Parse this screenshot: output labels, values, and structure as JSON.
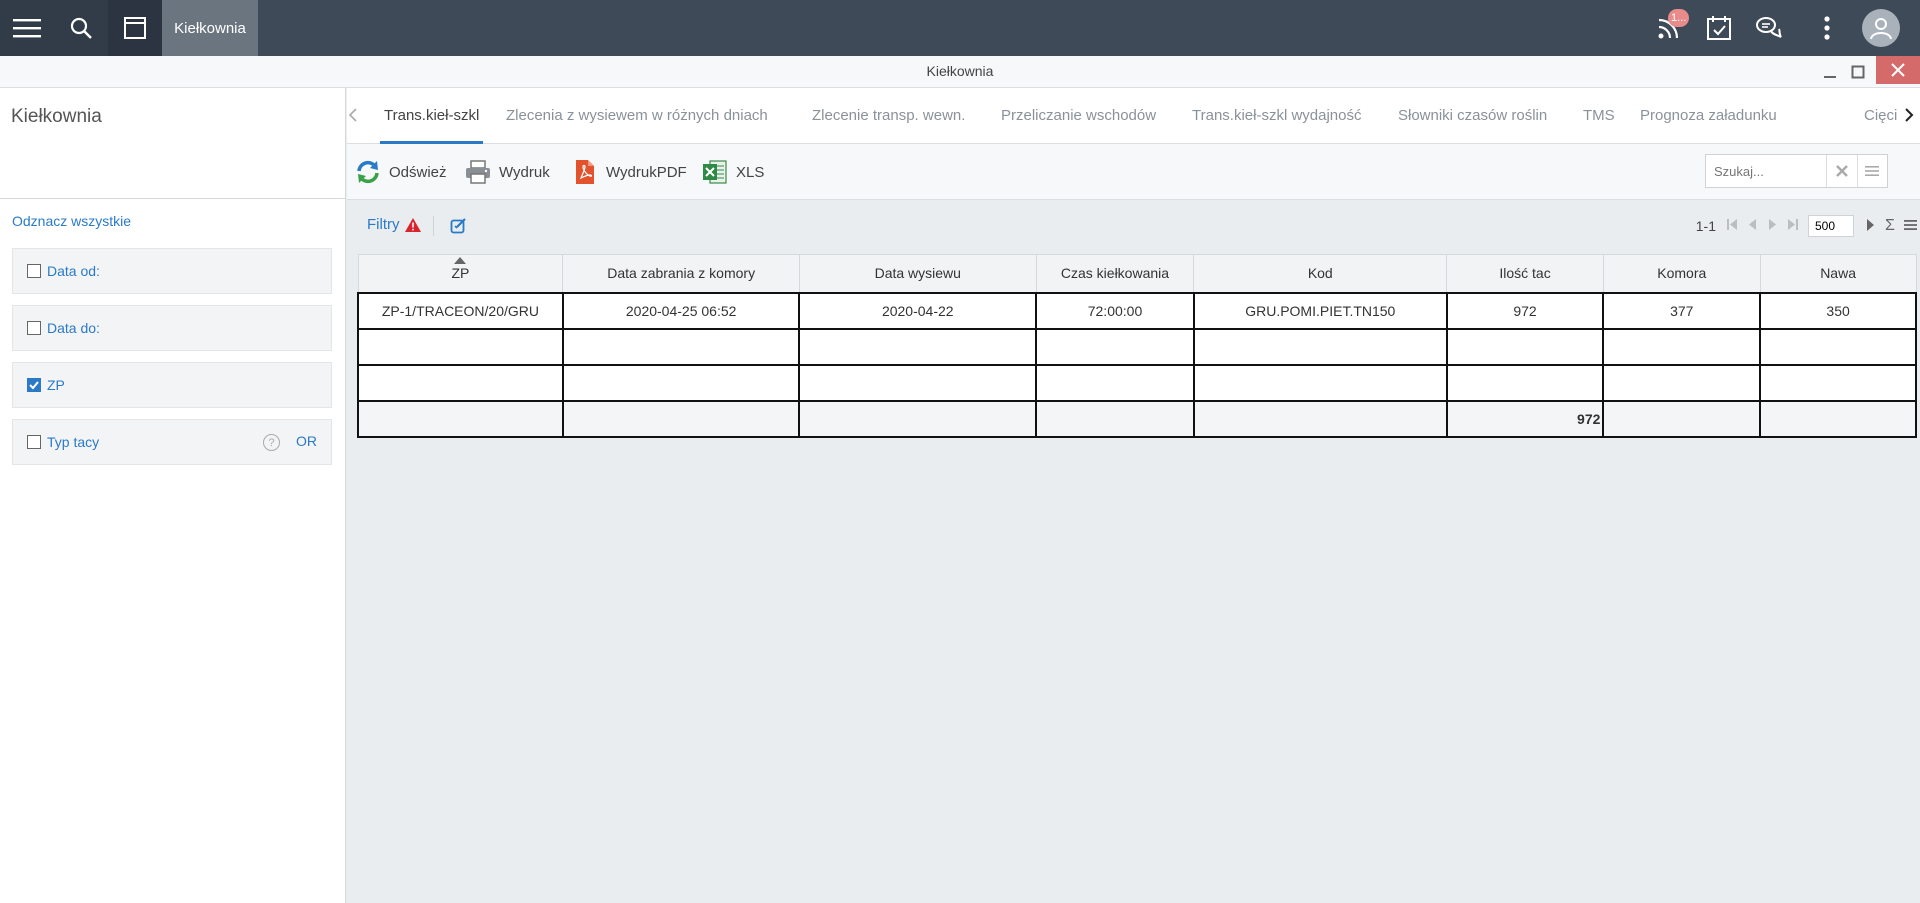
{
  "topbar": {
    "active_tab": "Kiełkownia",
    "badge_count": "1...",
    "icons": [
      "menu-icon",
      "search-icon",
      "window-icon",
      "rss-icon",
      "calendar-check-icon",
      "chat-icon",
      "more-vertical-icon",
      "user-icon"
    ]
  },
  "window": {
    "title": "Kiełkownia"
  },
  "left": {
    "title": "Kiełkownia",
    "toggle_all": "Odznacz wszystkie",
    "filters": [
      {
        "label": "Data od:",
        "checked": false
      },
      {
        "label": "Data do:",
        "checked": false
      },
      {
        "label": "ZP",
        "checked": true
      },
      {
        "label": "Typ tacy",
        "checked": false
      }
    ],
    "or_label": "OR",
    "help": "?"
  },
  "tabs": [
    "Trans.kieł-szkl",
    "Zlecenia z wysiewem w różnych dniach",
    "Zlecenie transp. wewn.",
    "Przeliczanie wschodów",
    "Trans.kieł-szkl wydajność",
    "Słowniki czasów roślin",
    "TMS",
    "Prognoza załadunku",
    "Cięci"
  ],
  "toolbar": {
    "refresh": "Odśwież",
    "print": "Wydruk",
    "pdf": "WydrukPDF",
    "xls": "XLS",
    "search_placeholder": "Szukaj..."
  },
  "filterbar": {
    "filters_label": "Filtry"
  },
  "pager": {
    "range": "1-1",
    "page_size": "500",
    "sigma": "Σ"
  },
  "grid": {
    "columns": [
      "ZP",
      "Data zabrania z komory",
      "Data wysiewu",
      "Czas kiełkowania",
      "Kod",
      "Ilość tac",
      "Komora",
      "Nawa"
    ],
    "rows": [
      [
        "ZP-1/TRACEON/20/GRU",
        "2020-04-25 06:52",
        "2020-04-22",
        "72:00:00",
        "GRU.POMI.PIET.TN150",
        "972",
        "377",
        "350"
      ]
    ],
    "sum_ilosc_tac": "972"
  },
  "colors": {
    "accent": "#2a7ac7",
    "topbar": "#3f4a58",
    "close": "#d46a6a"
  }
}
